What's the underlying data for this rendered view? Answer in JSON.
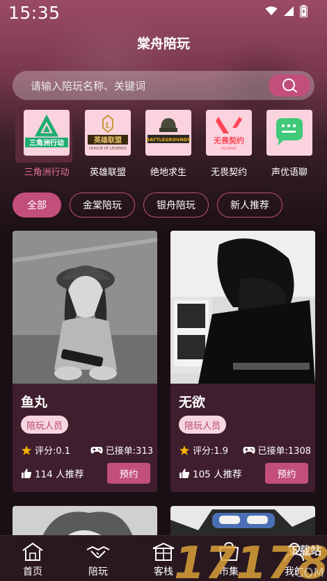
{
  "status": {
    "time": "15:35"
  },
  "app": {
    "title": "棠舟陪玩"
  },
  "search": {
    "placeholder": "请输入陪玩名称、关键词"
  },
  "games": [
    {
      "label": "三角洲行动",
      "icon": "delta-force-icon",
      "icon_text": "三角洲行动",
      "active": true
    },
    {
      "label": "英雄联盟",
      "icon": "league-of-legends-icon",
      "icon_text": "英雄联盟",
      "icon_subtext": "LEAGUE OF LEGENDS"
    },
    {
      "label": "绝地求生",
      "icon": "pubg-icon",
      "icon_text": "BATTLEGROUNDS"
    },
    {
      "label": "无畏契约",
      "icon": "valorant-icon",
      "icon_text": "无畏契约",
      "icon_subtext": "VALORANT"
    },
    {
      "label": "声优语聊",
      "icon": "voice-chat-icon"
    }
  ],
  "filters": [
    {
      "label": "全部",
      "active": true
    },
    {
      "label": "金棠陪玩"
    },
    {
      "label": "银舟陪玩"
    },
    {
      "label": "新人推荐"
    }
  ],
  "cards": [
    {
      "name": "鱼丸",
      "tag": "陪玩人员",
      "rating": "评分:0.1",
      "orders": "已接单:313",
      "recommend": "114 人推荐",
      "book": "预约"
    },
    {
      "name": "无欲",
      "tag": "陪玩人员",
      "rating": "评分:1.9",
      "orders": "已接单:1308",
      "recommend": "105 人推荐",
      "book": "预约"
    }
  ],
  "nav": [
    {
      "label": "首页",
      "icon": "home-icon"
    },
    {
      "label": "陪玩",
      "icon": "handshake-icon"
    },
    {
      "label": "客栈",
      "icon": "inn-icon"
    },
    {
      "label": "市集",
      "icon": "market-icon"
    },
    {
      "label": "我的",
      "icon": "profile-icon"
    }
  ],
  "watermark": {
    "text": "17178",
    "sub": "下载站",
    "domain": ".COM"
  },
  "colors": {
    "accent": "#c24f7a",
    "card_bg": "#3f1e2d",
    "star": "#f5b400"
  }
}
